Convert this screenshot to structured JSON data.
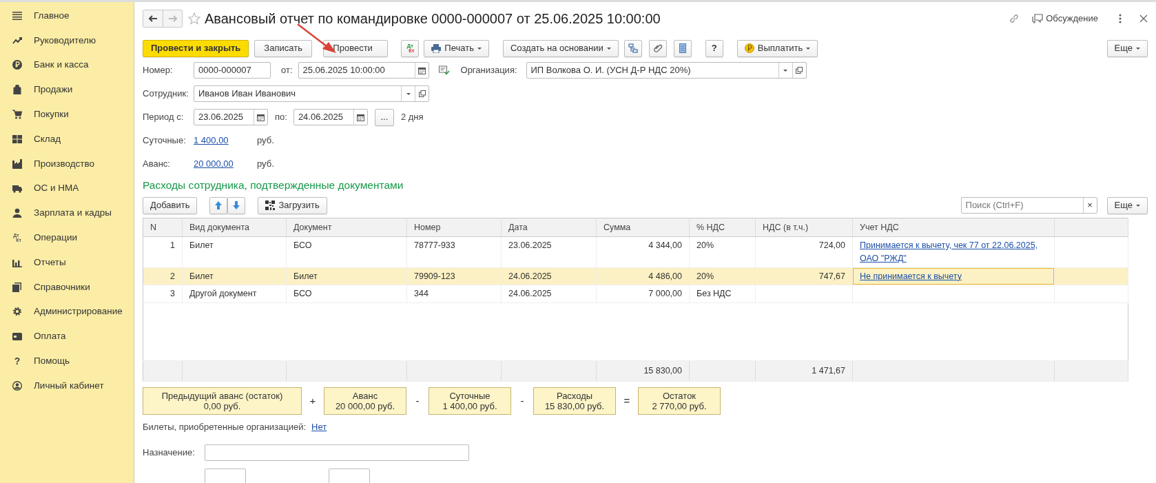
{
  "sidebar": {
    "items": [
      {
        "label": "Главное"
      },
      {
        "label": "Руководителю"
      },
      {
        "label": "Банк и касса"
      },
      {
        "label": "Продажи"
      },
      {
        "label": "Покупки"
      },
      {
        "label": "Склад"
      },
      {
        "label": "Производство"
      },
      {
        "label": "ОС и НМА"
      },
      {
        "label": "Зарплата и кадры"
      },
      {
        "label": "Операции",
        "icon_text": [
          "Дт",
          "Кт"
        ]
      },
      {
        "label": "Отчеты"
      },
      {
        "label": "Справочники"
      },
      {
        "label": "Администрирование"
      },
      {
        "label": "Оплата"
      },
      {
        "label": "Помощь",
        "icon_text": [
          "?"
        ]
      },
      {
        "label": "Личный кабинет"
      }
    ]
  },
  "header": {
    "title": "Авансовый отчет по командировке 0000-000007 от 25.06.2025 10:00:00",
    "back_disabled": false,
    "forward_disabled": true,
    "favorite": false,
    "discussion": "Обсуждение"
  },
  "toolbar": [
    {
      "kind": "primary",
      "label": "Провести и закрыть"
    },
    {
      "kind": "plain",
      "label": "Записать"
    },
    {
      "kind": "plain",
      "label": "Провести"
    },
    {
      "kind": "dtkt",
      "top": "Дт",
      "bottom": "Кт"
    },
    {
      "kind": "print",
      "label": "Печать"
    },
    {
      "kind": "dropdown",
      "label": "Создать на основании"
    },
    {
      "kind": "structure"
    },
    {
      "kind": "attach"
    },
    {
      "kind": "register"
    },
    {
      "kind": "help",
      "label": "?"
    },
    {
      "kind": "pay",
      "label": "Выплатить"
    },
    {
      "kind": "more",
      "label": "Еще"
    }
  ],
  "form": {
    "number": {
      "label": "Номер:",
      "value": "0000-000007"
    },
    "date": {
      "label": "от:",
      "value": "25.06.2025 10:00:00"
    },
    "organization": {
      "label": "Организация:",
      "value": "ИП Волкова О. И. (УСН Д-Р НДС 20%)"
    },
    "employee": {
      "label": "Сотрудник:",
      "value": "Иванов Иван Иванович"
    },
    "period": {
      "label": "Период с:",
      "from": "23.06.2025",
      "to_label": "по:",
      "to": "24.06.2025",
      "select": "...",
      "days": "2 дня"
    },
    "per_diem": {
      "label": "Суточные:",
      "value": "1 400,00",
      "unit": "руб."
    },
    "advance": {
      "label": "Аванс:",
      "value": "20 000,00",
      "unit": "руб."
    }
  },
  "expenses": {
    "title": "Расходы сотрудника, подтвержденные документами",
    "add": "Добавить",
    "load": "Загрузить",
    "search_placeholder": "Поиск (Ctrl+F)",
    "clear": "×",
    "more": "Еще",
    "table": {
      "columns": [
        "N",
        "Вид документа",
        "Документ",
        "Номер",
        "Дата",
        "Сумма",
        "% НДС",
        "НДС (в т.ч.)",
        "Учет НДС"
      ],
      "rows": [
        {
          "selected": false,
          "n": "1",
          "doc_type": "Билет",
          "document": "БСО",
          "number": "78777-933",
          "date": "23.06.2025",
          "sum": "4 344,00",
          "vat_rate": "20%",
          "vat": "724,00",
          "vat_accounting": "Принимается к вычету, чек 77 от 22.06.2025, ОАО \"РЖД\""
        },
        {
          "selected": true,
          "n": "2",
          "doc_type": "Билет",
          "document": "Билет",
          "number": "79909-123",
          "date": "24.06.2025",
          "sum": "4 486,00",
          "vat_rate": "20%",
          "vat": "747,67",
          "vat_accounting": "Не принимается к вычету"
        },
        {
          "selected": false,
          "n": "3",
          "doc_type": "Другой документ",
          "document": "БСО",
          "number": "344",
          "date": "24.06.2025",
          "sum": "7 000,00",
          "vat_rate": "Без НДС"
        }
      ],
      "totals": {
        "sum": "15 830,00",
        "vat": "1 471,67"
      }
    }
  },
  "summary": [
    {
      "kind": "box",
      "title": "Предыдущий аванс (остаток)",
      "value": "0,00 руб."
    },
    {
      "kind": "op",
      "text": "+"
    },
    {
      "kind": "box",
      "title": "Аванс",
      "value": "20 000,00 руб."
    },
    {
      "kind": "op",
      "text": "-"
    },
    {
      "kind": "box",
      "title": "Суточные",
      "value": "1 400,00 руб."
    },
    {
      "kind": "op",
      "text": "-"
    },
    {
      "kind": "box",
      "title": "Расходы",
      "value": "15 830,00 руб."
    },
    {
      "kind": "op",
      "text": "="
    },
    {
      "kind": "box",
      "title": "Остаток",
      "value": "2 770,00 руб."
    }
  ],
  "tickets": {
    "label": "Билеты, приобретенные организацией:",
    "value": "Нет"
  },
  "purpose": {
    "label": "Назначение:"
  }
}
